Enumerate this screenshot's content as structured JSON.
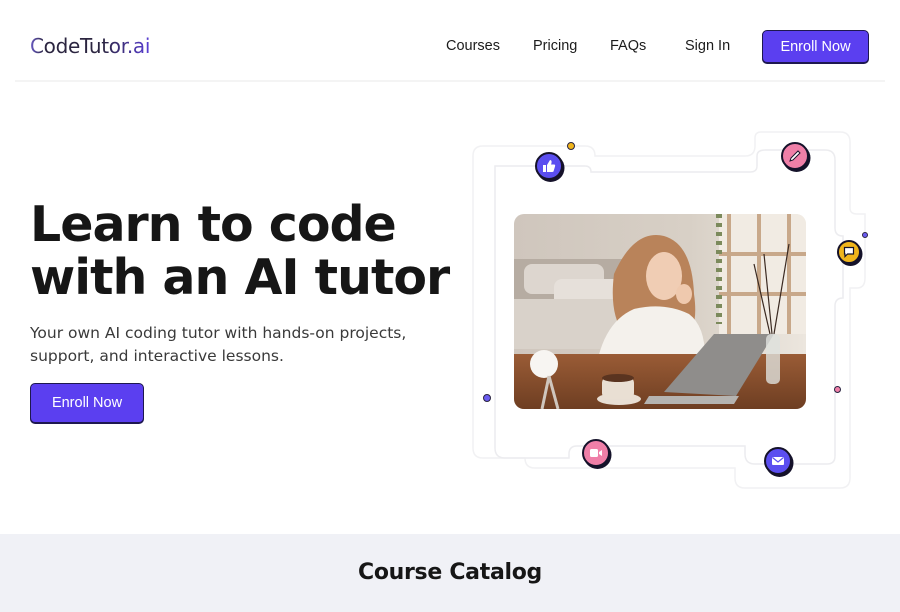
{
  "header": {
    "logo_text": "CodeTutor.ai",
    "nav": [
      "Courses",
      "Pricing",
      "FAQs",
      "Sign In"
    ],
    "cta_label": "Enroll Now"
  },
  "hero": {
    "title_line1": "Learn to code",
    "title_line2": "with an AI tutor",
    "subtitle": "Your own AI coding tutor with hands-on projects, support, and interactive lessons.",
    "cta_label": "Enroll Now",
    "illustration": {
      "photo_alt": "Smiling woman at a laptop with a cup of coffee",
      "icons": [
        "thumbs-up-icon",
        "pencil-icon",
        "chat-icon",
        "video-icon",
        "mail-icon"
      ]
    }
  },
  "catalog": {
    "title": "Course Catalog"
  },
  "colors": {
    "accent": "#5b3ff0",
    "pink": "#ef7fa8",
    "yellow": "#f0b51b",
    "catalog_bg": "#f0f1f6"
  }
}
